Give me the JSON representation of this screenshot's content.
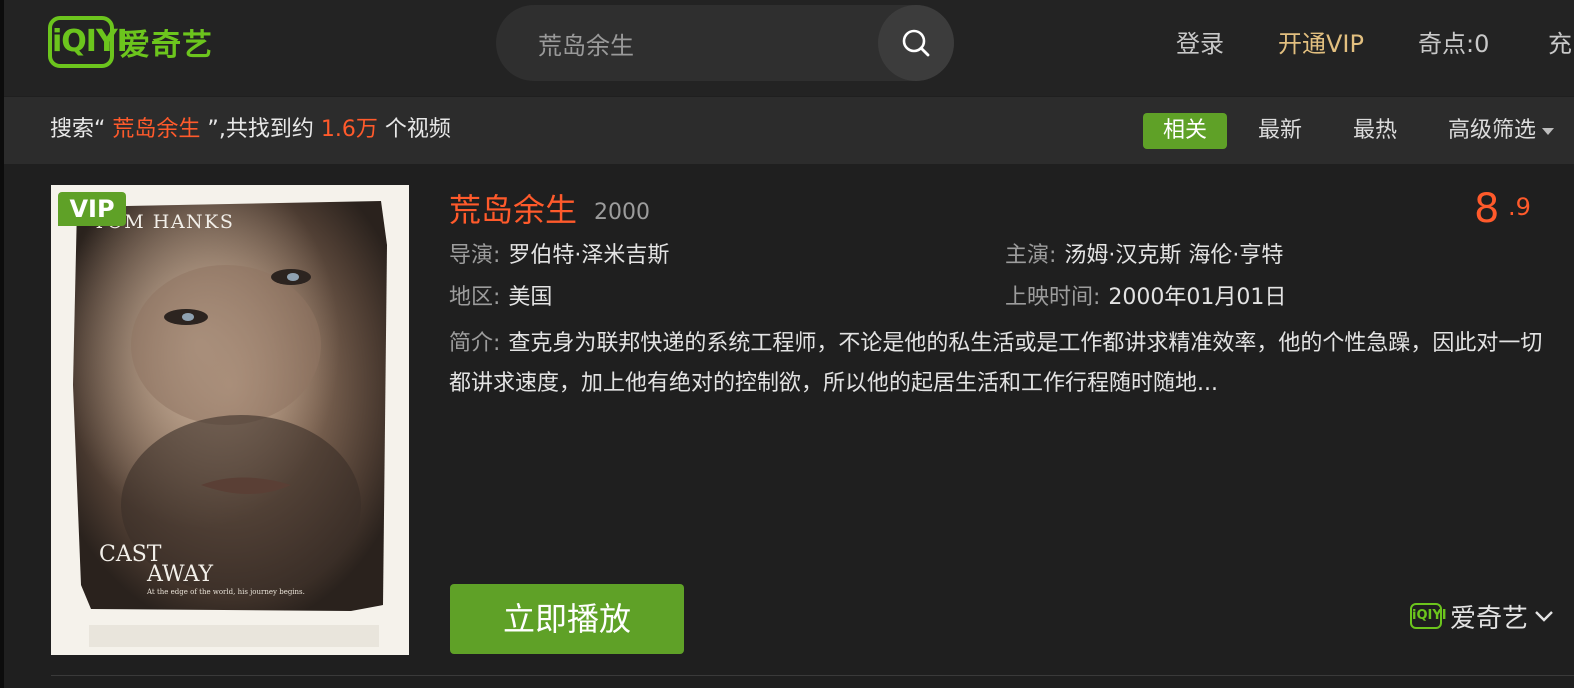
{
  "header": {
    "logo_badge": "iQIYI",
    "logo_text": "爱奇艺",
    "search_value": "荒岛余生",
    "nav": {
      "login": "登录",
      "vip": "开通VIP",
      "points": "奇点:0",
      "recharge": "充"
    }
  },
  "filter_bar": {
    "summary_prefix": "搜索“",
    "summary_query": "荒岛余生",
    "summary_middle": "”,共找到约",
    "summary_count": "1.6万",
    "summary_suffix": "个视频",
    "tabs": [
      "相关",
      "最新",
      "最热",
      "高级筛选"
    ]
  },
  "result": {
    "vip_badge": "VIP",
    "poster": {
      "line_top": "TOM HANKS",
      "line_title1": "CAST",
      "line_title2": "AWAY",
      "tagline": "At the edge of the world, his journey begins."
    },
    "title": "荒岛余生",
    "year": "2000",
    "score_int": "8",
    "score_dec": ".9",
    "director_label": "导演:",
    "director": "罗伯特·泽米吉斯",
    "cast_label": "主演:",
    "cast": "汤姆·汉克斯 海伦·亨特",
    "region_label": "地区:",
    "region": "美国",
    "release_label": "上映时间:",
    "release": "2000年01月01日",
    "desc_label": "简介:",
    "desc": "查克身为联邦快递的系统工程师，不论是他的私生活或是工作都讲求精准效率，他的个性急躁，因此对一切都讲求速度，加上他有绝对的控制欲，所以他的起居生活和工作行程随时随地...",
    "play_label": "立即播放",
    "source_badge": "iQIYI",
    "source_name": "爱奇艺"
  },
  "colors": {
    "accent": "#ff5a2b",
    "brand_green": "#5fa127",
    "vip_gold": "#e2bf7f"
  },
  "icons": {
    "search": "search-icon",
    "source_dropdown": "chevron-down-icon"
  }
}
